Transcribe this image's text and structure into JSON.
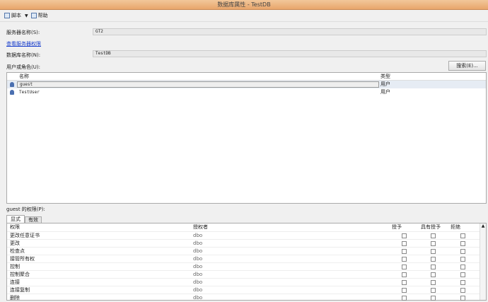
{
  "window": {
    "title": "数据库属性 - TestDB"
  },
  "toolbar": {
    "script": "脚本",
    "help": "帮助"
  },
  "server": {
    "label": "服务器名称(S):",
    "value": "GT2"
  },
  "view_server_permissions": "查看服务器权限",
  "database": {
    "label": "数据库名称(N):",
    "value": "TestDB"
  },
  "users": {
    "label": "用户或角色(U):",
    "search_button": "搜索(E)...",
    "columns": [
      "名称",
      "类型"
    ],
    "rows": [
      {
        "name": "guest",
        "type": "用户"
      },
      {
        "name": "TestUser",
        "type": "用户"
      }
    ]
  },
  "permissions": {
    "label": "guest 的权限(P):",
    "tabs": [
      "显式",
      "有效"
    ],
    "columns": [
      "权限",
      "授权者",
      "授予",
      "具有授予",
      "拒绝"
    ],
    "rows": [
      {
        "name": "更改任意证书",
        "grantor": "dbo"
      },
      {
        "name": "更改",
        "grantor": "dbo"
      },
      {
        "name": "检查点",
        "grantor": "dbo"
      },
      {
        "name": "接管所有权",
        "grantor": "dbo"
      },
      {
        "name": "控制",
        "grantor": "dbo"
      },
      {
        "name": "控制聚合",
        "grantor": "dbo"
      },
      {
        "name": "连接",
        "grantor": "dbo"
      },
      {
        "name": "连接复制",
        "grantor": "dbo"
      },
      {
        "name": "删除",
        "grantor": "dbo"
      }
    ]
  }
}
